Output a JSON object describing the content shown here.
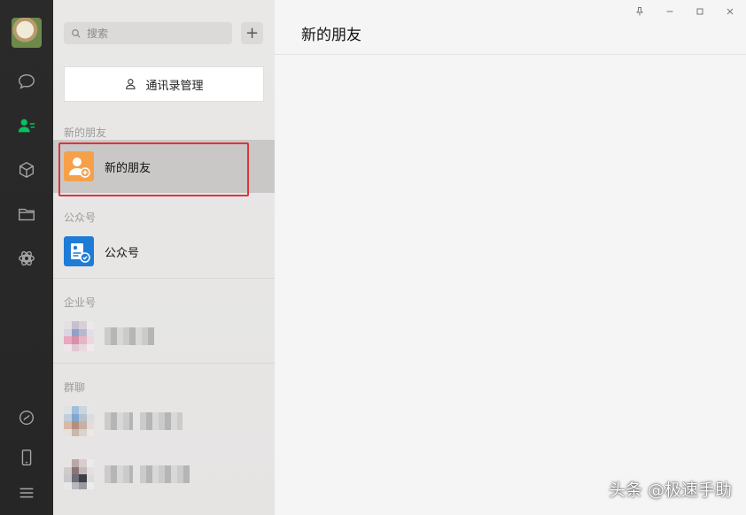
{
  "search": {
    "placeholder": "搜索"
  },
  "panel": {
    "manage_label": "通讯录管理",
    "sections": {
      "new_friends": "新的朋友",
      "official": "公众号",
      "enterprise": "企业号",
      "groups": "群聊"
    },
    "rows": {
      "new_friends": "新的朋友",
      "official": "公众号"
    }
  },
  "main": {
    "title": "新的朋友"
  },
  "watermark": "头条 @极速手助",
  "colors": {
    "rail_bg": "#2a2a2a",
    "active_icon": "#07c160",
    "new_friends_icon_bg": "#f6a04a",
    "official_icon_bg": "#1e7bd6",
    "highlight_border": "#e0323c"
  },
  "icons": {
    "rail": [
      "chat-icon",
      "contacts-icon",
      "cube-icon",
      "folder-icon",
      "mini-program-icon",
      "moments-icon",
      "phone-icon",
      "menu-icon"
    ]
  }
}
